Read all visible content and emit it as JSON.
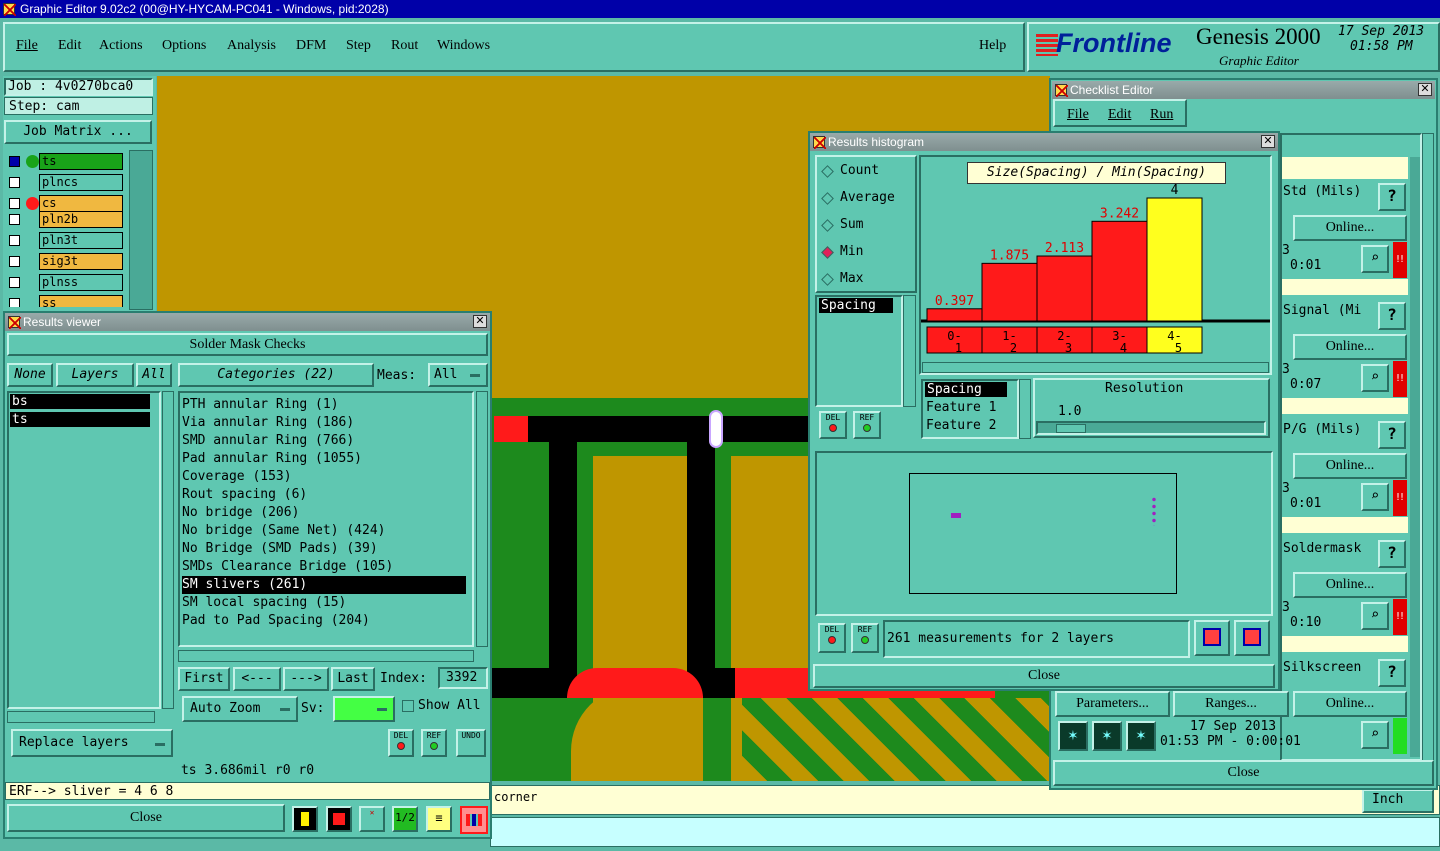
{
  "window": {
    "title": "Graphic Editor 9.02c2 (00@HY-HYCAM-PC041 - Windows, pid:2028)"
  },
  "menu": {
    "items": [
      "File",
      "Edit",
      "Actions",
      "Options",
      "Analysis",
      "DFM",
      "Step",
      "Rout",
      "Windows"
    ],
    "help": "Help"
  },
  "brand": {
    "logo": "Frontline",
    "product": "Genesis 2000",
    "subtitle": "Graphic Editor",
    "date": "17 Sep 2013",
    "time": "01:58 PM"
  },
  "job": {
    "job": "Job : 4v0270bca0",
    "step": "Step: cam",
    "matrix_button": "Job Matrix ..."
  },
  "layers": [
    "ts",
    "plncs",
    "cs",
    "pln2b",
    "pln3t",
    "sig3t",
    "plnss",
    "ss"
  ],
  "results_viewer": {
    "title": "Results viewer",
    "heading": "Solder Mask Checks",
    "none": "None",
    "layers": "Layers",
    "all": "All",
    "layer_list": [
      "bs",
      "ts"
    ],
    "categories_label": "Categories (22)",
    "meas_label": "Meas:",
    "meas_value": "All",
    "categories": [
      "PTH annular Ring (1)",
      "Via annular Ring (186)",
      "SMD annular Ring (766)",
      "Pad annular Ring (1055)",
      "Coverage (153)",
      "Rout spacing (6)",
      "No bridge (206)",
      "No bridge (Same Net) (424)",
      "No Bridge (SMD Pads) (39)",
      "SMDs Clearance Bridge (105)",
      "SM slivers (261)",
      "SM local spacing (15)",
      "Pad to Pad Spacing (204)"
    ],
    "selected_category": "SM slivers (261)",
    "first": "First",
    "prev": "<---",
    "next": "--->",
    "last": "Last",
    "index_label": "Index:",
    "index_value": "3392",
    "auto_zoom": "Auto Zoom",
    "sv_label": "Sv:",
    "show_all": "Show All",
    "replace_layers": "Replace layers",
    "status": "ts 3.686mil  r0  r0",
    "erf": "ERF--> sliver = 4 6 8",
    "close": "Close",
    "del": "DEL",
    "ref": "REF",
    "undo": "UNDO"
  },
  "histogram": {
    "title": "Results histogram",
    "options": [
      "Count",
      "Average",
      "Sum",
      "Min",
      "Max"
    ],
    "selected_option": "Min",
    "list": [
      "Spacing"
    ],
    "resolution_list": [
      "Spacing",
      "Feature 1",
      "Feature 2"
    ],
    "resolution_label": "Resolution",
    "resolution_value": "1.0",
    "summary": "261 measurements for 2 layers",
    "close": "Close",
    "del": "DEL",
    "ref": "REF"
  },
  "chart_data": {
    "type": "bar",
    "title": "Size(Spacing) / Min(Spacing)",
    "categories": [
      "0-1",
      "1-2",
      "2-3",
      "3-4",
      "4-5"
    ],
    "values": [
      0.397,
      1.875,
      2.113,
      3.242,
      4
    ],
    "value_labels": [
      "0.397",
      "1.875",
      "2.113",
      "3.242",
      "4"
    ],
    "colors": [
      "#ff1a1a",
      "#ff1a1a",
      "#ff1a1a",
      "#ff1a1a",
      "#ffff1e"
    ],
    "ylim": [
      0,
      4
    ],
    "grid": false
  },
  "checklist": {
    "title": "Checklist Editor",
    "menu": [
      "File",
      "Edit",
      "Run"
    ],
    "rows": [
      {
        "name": "Std (Mils)",
        "action": "Online...",
        "time": "0:01",
        "seq": "3"
      },
      {
        "name": "Signal (Mi",
        "action": "Online...",
        "time": "0:07",
        "seq": "3"
      },
      {
        "name": "P/G (Mils)",
        "action": "Online...",
        "time": "0:01",
        "seq": "3"
      },
      {
        "name": "Soldermask",
        "action": "Online...",
        "time": "0:10",
        "seq": "3"
      },
      {
        "name": "Silkscreen",
        "action": "Online...",
        "time": "",
        "seq": ""
      }
    ],
    "parameters": "Parameters...",
    "ranges": "Ranges...",
    "online": "Online...",
    "date": "17 Sep 2013",
    "timestamp": "01:53 PM - 0:00:01",
    "help_glyph": "?",
    "warn_glyph": "!!",
    "close": "Close"
  },
  "statusbar": {
    "hint": "corner",
    "units": "Inch"
  },
  "colors": {
    "accent": "#0000a8",
    "panel": "#5fc7b1",
    "copper": "#bf9600",
    "red": "#ff1a1a",
    "yellow": "#ffff1e"
  }
}
